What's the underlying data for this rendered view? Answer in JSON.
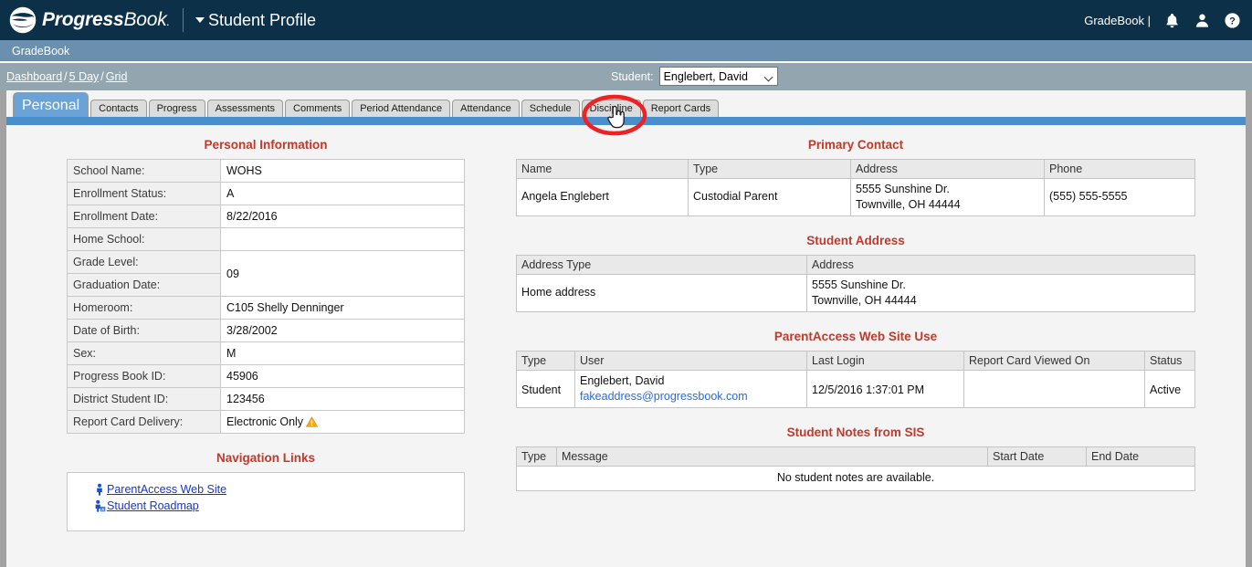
{
  "app": {
    "logo_text_bold": "Progress",
    "logo_text_light": "Book",
    "logo_dot": ".",
    "module_title": "Student Profile",
    "right_label": "GradeBook |",
    "icons": [
      "bell-icon",
      "user-icon",
      "help-icon"
    ]
  },
  "subbar": {
    "label": "GradeBook"
  },
  "breadcrumb": {
    "items": [
      "Dashboard",
      "5 Day",
      "Grid"
    ],
    "separator": "/"
  },
  "student_selector": {
    "label": "Student:",
    "value": "Englebert, David"
  },
  "tabs": [
    {
      "label": "Personal",
      "active": true
    },
    {
      "label": "Contacts",
      "active": false
    },
    {
      "label": "Progress",
      "active": false
    },
    {
      "label": "Assessments",
      "active": false
    },
    {
      "label": "Comments",
      "active": false
    },
    {
      "label": "Period Attendance",
      "active": false
    },
    {
      "label": "Attendance",
      "active": false
    },
    {
      "label": "Schedule",
      "active": false
    },
    {
      "label": "Discipline",
      "active": false
    },
    {
      "label": "Report Cards",
      "active": false
    }
  ],
  "annotation": {
    "target_tab": "Discipline",
    "ellipse_color": "#ee2222",
    "cursor": "pointing-hand-cursor"
  },
  "personal_information": {
    "title": "Personal Information",
    "rows": [
      {
        "key": "School Name:",
        "value": "WOHS"
      },
      {
        "key": "Enrollment Status:",
        "value": "A"
      },
      {
        "key": "Enrollment Date:",
        "value": "8/22/2016"
      },
      {
        "key": "Home School:",
        "value": ""
      },
      {
        "key": "Grade Level:",
        "value": "09"
      },
      {
        "key": "Graduation Date:",
        "value": ""
      },
      {
        "key": "Homeroom:",
        "value": "C105 Shelly Denninger"
      },
      {
        "key": "Date of Birth:",
        "value": "3/28/2002"
      },
      {
        "key": "Sex:",
        "value": "M"
      },
      {
        "key": "Progress Book ID:",
        "value": "45906"
      },
      {
        "key": "District Student ID:",
        "value": "123456"
      },
      {
        "key": "Report Card Delivery:",
        "value": "Electronic Only",
        "warning_icon": "warning-triangle-icon"
      }
    ]
  },
  "navigation_links": {
    "title": "Navigation Links",
    "links": [
      {
        "label": "ParentAccess Web Site",
        "icon": "person-icon"
      },
      {
        "label": "Student Roadmap",
        "icon": "person-roadmap-icon"
      }
    ]
  },
  "primary_contact": {
    "title": "Primary Contact",
    "headers": [
      "Name",
      "Type",
      "Address",
      "Phone"
    ],
    "rows": [
      {
        "name": "Angela Englebert",
        "type": "Custodial Parent",
        "address_line1": "5555 Sunshine Dr.",
        "address_line2": "Townville, OH 44444",
        "phone": "(555) 555-5555"
      }
    ]
  },
  "student_address": {
    "title": "Student Address",
    "headers": [
      "Address Type",
      "Address"
    ],
    "rows": [
      {
        "address_type": "Home address",
        "address_line1": "5555 Sunshine Dr.",
        "address_line2": "Townville, OH 44444"
      }
    ]
  },
  "parentaccess_use": {
    "title": "ParentAccess Web Site Use",
    "headers": [
      "Type",
      "User",
      "Last Login",
      "Report Card Viewed On",
      "Status"
    ],
    "rows": [
      {
        "type": "Student",
        "user_name": "Englebert, David",
        "user_email": "fakeaddress@progressbook.com",
        "last_login": "12/5/2016 1:37:01 PM",
        "report_card_viewed_on": "",
        "status": "Active"
      }
    ]
  },
  "student_notes": {
    "title": "Student Notes from SIS",
    "headers": [
      "Type",
      "Message",
      "Start Date",
      "End Date"
    ],
    "empty_message": "No student notes are available."
  },
  "colors": {
    "navy": "#0c3048",
    "subbar_blue": "#6b8fae",
    "crumb_gray": "#93a5ae",
    "rule_blue": "#4a8fcc",
    "section_red": "#c0392b",
    "link_blue": "#1a35c8",
    "frame_gray": "#a2a2a2"
  }
}
